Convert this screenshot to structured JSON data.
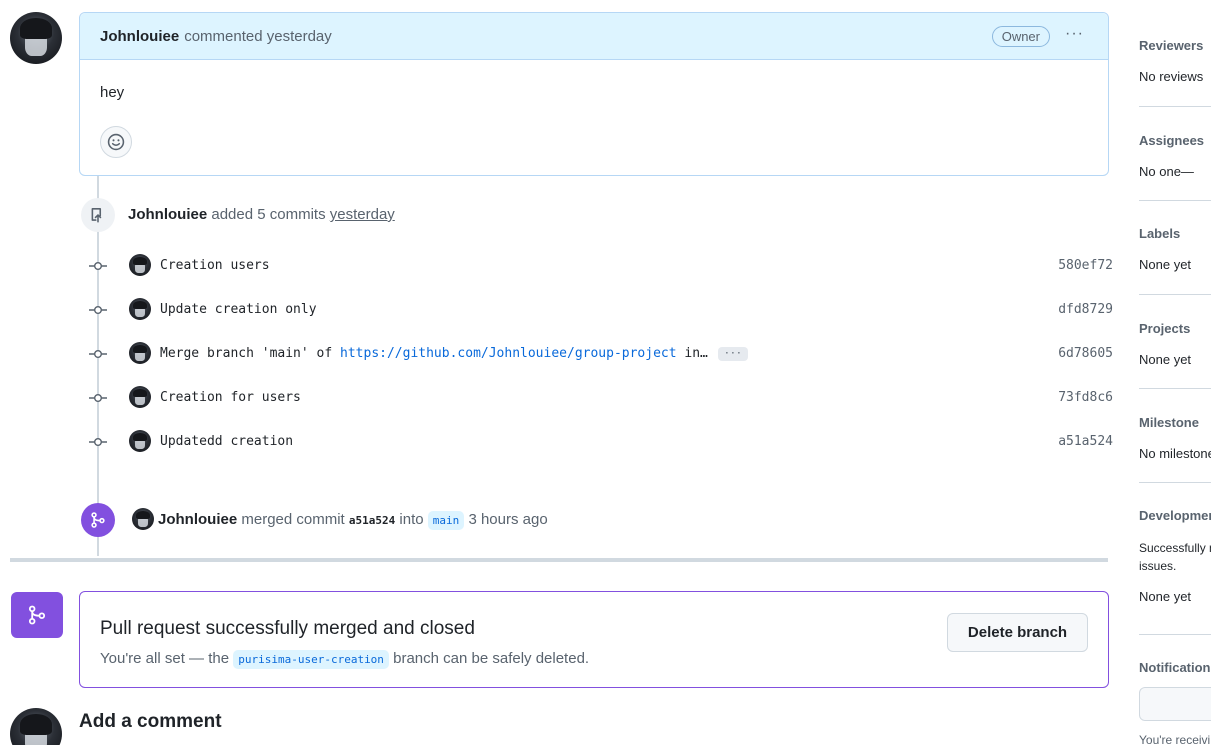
{
  "comment": {
    "author": "Johnlouiee",
    "action": "commented yesterday",
    "badge": "Owner",
    "menu": "···",
    "body": "hey"
  },
  "commits_event": {
    "author": "Johnlouiee",
    "action": "added 5 commits",
    "time": "yesterday"
  },
  "commits": [
    {
      "message": "Creation users",
      "sha": "580ef72"
    },
    {
      "message": "Update creation only",
      "sha": "dfd8729"
    },
    {
      "message_prefix": "Merge branch 'main' of ",
      "link": "https://github.com/Johnlouiee/group-project",
      "message_suffix": " in…",
      "more": "···",
      "sha": "6d78605"
    },
    {
      "message": "Creation for users",
      "sha": "73fd8c6"
    },
    {
      "message": "Updatedd creation",
      "sha": "a51a524"
    }
  ],
  "merge_event": {
    "author": "Johnlouiee",
    "action": "merged commit",
    "sha": "a51a524",
    "into": "into",
    "branch": "main",
    "time": "3 hours ago"
  },
  "merge_box": {
    "title": "Pull request successfully merged and closed",
    "sub_prefix": "You're all set — the",
    "branch": "purisima-user-creation",
    "sub_suffix": "branch can be safely deleted.",
    "delete_label": "Delete branch"
  },
  "add_comment": {
    "title": "Add a comment"
  },
  "sidebar": {
    "reviewers": {
      "title": "Reviewers",
      "value": "No reviews"
    },
    "assignees": {
      "title": "Assignees",
      "value": "No one—"
    },
    "labels": {
      "title": "Labels",
      "value": "None yet"
    },
    "projects": {
      "title": "Projects",
      "value": "None yet"
    },
    "milestone": {
      "title": "Milestone",
      "value": "No milestone"
    },
    "development": {
      "title": "Development",
      "value": "Successfully merging this pull request may close these",
      "value2": "issues.",
      "value3": "None yet"
    },
    "notifications": {
      "title": "Notifications",
      "footer": "You're receiving"
    }
  },
  "colors": {
    "accent": "#0969da",
    "merged": "#8250df",
    "header_bg": "#ddf4ff"
  }
}
